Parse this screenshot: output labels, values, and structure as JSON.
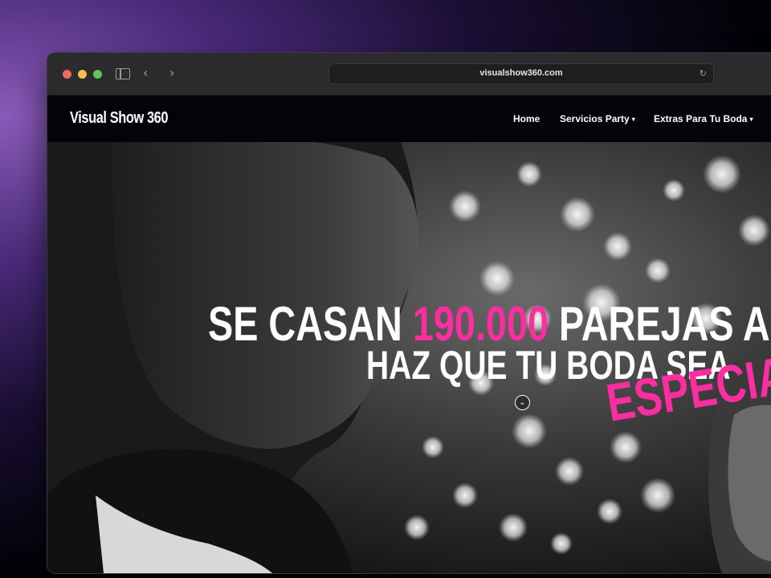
{
  "browser": {
    "url": "visualshow360.com"
  },
  "site": {
    "logo": "Visual Show 360",
    "nav": {
      "home": "Home",
      "servicios": "Servicios Party",
      "extras": "Extras Para Tu Boda",
      "caret": "▾"
    }
  },
  "hero": {
    "headline_part1": "SE CASAN ",
    "headline_number": "190.000",
    "headline_part2": " PAREJAS AL AÑO",
    "subline": "HAZ QUE TU BODA SEA",
    "emphasis": "ESPECIAL",
    "accent_color": "#ff2da0"
  },
  "icons": {
    "back": "‹",
    "forward": "›",
    "reload": "↻",
    "scroll_down": "⌄"
  }
}
